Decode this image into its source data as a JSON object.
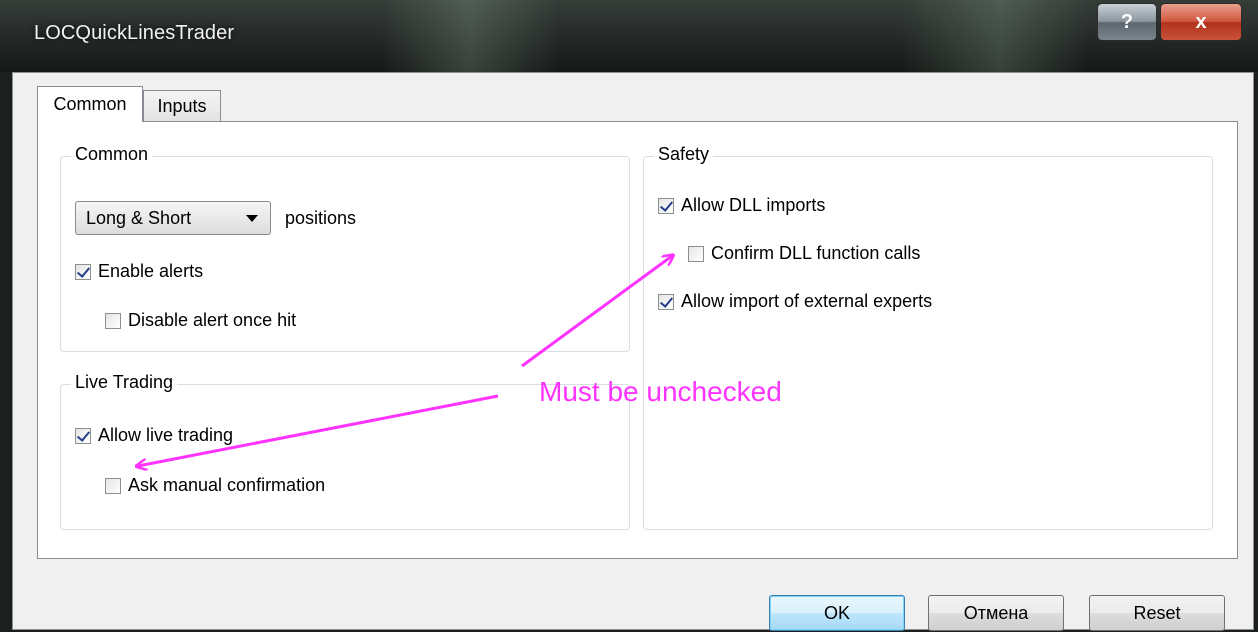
{
  "window": {
    "title": "LOCQuickLinesTrader",
    "help_label": "?",
    "close_label": "x"
  },
  "tabs": [
    {
      "label": "Common",
      "active": true
    },
    {
      "label": "Inputs",
      "active": false
    }
  ],
  "common_group": {
    "legend": "Common",
    "positions_select_value": "Long & Short",
    "positions_label": "positions",
    "enable_alerts": {
      "label": "Enable alerts",
      "checked": true
    },
    "disable_alert_once_hit": {
      "label": "Disable alert once hit",
      "checked": false
    }
  },
  "live_trading_group": {
    "legend": "Live Trading",
    "allow_live_trading": {
      "label": "Allow live trading",
      "checked": true
    },
    "ask_manual_confirmation": {
      "label": "Ask manual confirmation",
      "checked": false
    }
  },
  "safety_group": {
    "legend": "Safety",
    "allow_dll_imports": {
      "label": "Allow DLL imports",
      "checked": true
    },
    "confirm_dll_function_calls": {
      "label": "Confirm DLL function calls",
      "checked": false
    },
    "allow_import_external_experts": {
      "label": "Allow import of external experts",
      "checked": true
    }
  },
  "buttons": {
    "ok": "OK",
    "cancel": "Отмена",
    "reset": "Reset"
  },
  "annotation": {
    "text": "Must be unchecked",
    "color": "#ff33ff"
  }
}
